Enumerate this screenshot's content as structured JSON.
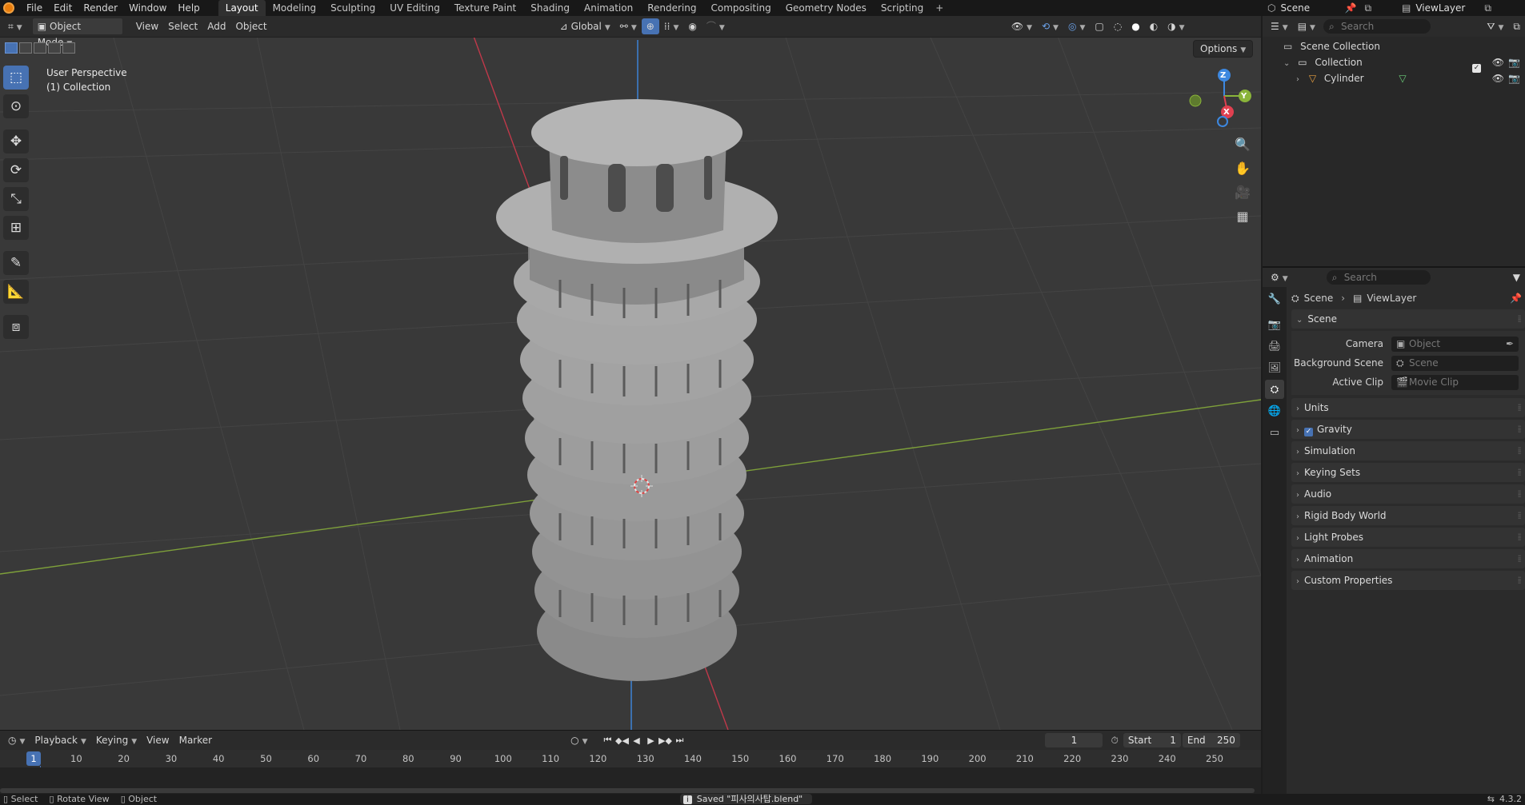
{
  "menubar": {
    "menus": [
      "File",
      "Edit",
      "Render",
      "Window",
      "Help"
    ],
    "workspaces": [
      "Layout",
      "Modeling",
      "Sculpting",
      "UV Editing",
      "Texture Paint",
      "Shading",
      "Animation",
      "Rendering",
      "Compositing",
      "Geometry Nodes",
      "Scripting"
    ],
    "active_workspace": "Layout",
    "scene_name": "Scene",
    "view_layer_name": "ViewLayer"
  },
  "viewport": {
    "mode": "Object Mode",
    "menus": [
      "View",
      "Select",
      "Add",
      "Object"
    ],
    "transform_orientation": "Global",
    "options_label": "Options",
    "overlay_text": [
      "User Perspective",
      "(1) Collection"
    ],
    "gizmo_labels": {
      "z": "Z",
      "y": "Y",
      "x": "X"
    }
  },
  "outliner": {
    "search_placeholder": "Search",
    "items": [
      {
        "label": "Scene Collection",
        "depth": 0
      },
      {
        "label": "Collection",
        "depth": 1
      },
      {
        "label": "Cylinder",
        "depth": 2
      }
    ]
  },
  "properties": {
    "search_placeholder": "Search",
    "breadcrumb": [
      "Scene",
      "ViewLayer"
    ],
    "scene_panel": {
      "title": "Scene",
      "fields": [
        {
          "label": "Camera",
          "placeholder": "Object"
        },
        {
          "label": "Background Scene",
          "placeholder": "Scene"
        },
        {
          "label": "Active Clip",
          "placeholder": "Movie Clip"
        }
      ]
    },
    "panels": [
      "Units",
      "Gravity",
      "Simulation",
      "Keying Sets",
      "Audio",
      "Rigid Body World",
      "Light Probes",
      "Animation",
      "Custom Properties"
    ],
    "gravity_checked": true
  },
  "timeline": {
    "menus": [
      "Playback",
      "Keying",
      "View",
      "Marker"
    ],
    "current_frame": "1",
    "start_label": "Start",
    "start": "1",
    "end_label": "End",
    "end": "250",
    "ticks": [
      "1",
      "10",
      "20",
      "30",
      "40",
      "50",
      "60",
      "70",
      "80",
      "90",
      "100",
      "110",
      "120",
      "130",
      "140",
      "150",
      "160",
      "170",
      "180",
      "190",
      "200",
      "210",
      "220",
      "230",
      "240",
      "250"
    ]
  },
  "statusbar": {
    "items": [
      "Select",
      "Rotate View",
      "Object"
    ],
    "message": "Saved \"피사의사탑.blend\"",
    "version": "4.3.2"
  },
  "colors": {
    "accent": "#4772b3",
    "x_axis": "#e04050",
    "y_axis": "#8ab43a",
    "z_axis": "#3d88e0"
  }
}
